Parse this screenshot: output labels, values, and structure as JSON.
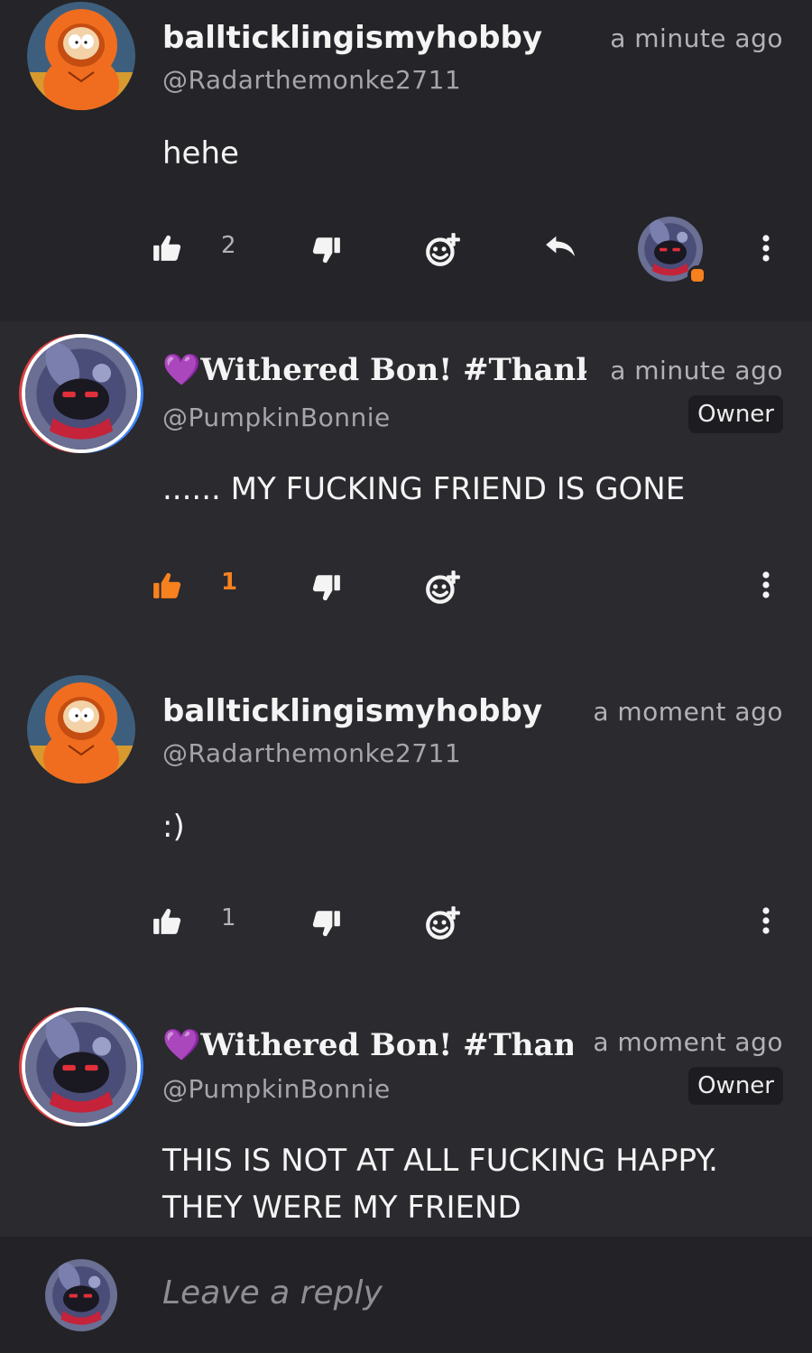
{
  "comments": [
    {
      "name": "ballticklingismyhobby",
      "handle": "@Radarthemonke2711",
      "time": "a minute ago",
      "text": "hehe",
      "likes": "2"
    },
    {
      "name_prefix": "💜",
      "name": "Withered Bon! #ThankYo",
      "handle": "@PumpkinBonnie",
      "time": "a minute ago",
      "badge": "Owner",
      "text": "...... MY FUCKING FRIEND IS GONE",
      "likes": "1"
    },
    {
      "name": "ballticklingismyhobby",
      "handle": "@Radarthemonke2711",
      "time": "a moment ago",
      "text": ":)",
      "likes": "1"
    },
    {
      "name_prefix": "💜",
      "name": "Withered Bon! #ThankY",
      "handle": "@PumpkinBonnie",
      "time": "a moment ago",
      "badge": "Owner",
      "text_line1": "THIS IS NOT AT ALL FUCKING HAPPY.",
      "text_line2": "THEY WERE MY FRIEND"
    }
  ],
  "reply": {
    "placeholder": "Leave a reply"
  },
  "colors": {
    "accent": "#f7811f",
    "heart": "#b44dff",
    "background": "#2b2a2f"
  },
  "icons": [
    "like-icon",
    "dislike-icon",
    "emoji-react-icon",
    "reply-icon",
    "more-icon"
  ]
}
